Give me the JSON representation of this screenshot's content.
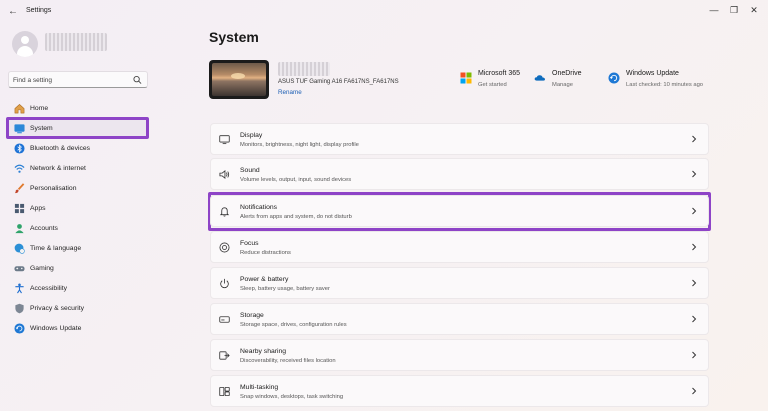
{
  "window": {
    "title": "Settings",
    "back_glyph": "←",
    "controls": {
      "minimize": "—",
      "maximize": "❐",
      "close": "✕"
    }
  },
  "account": {
    "avatar": "user-avatar",
    "name_redacted": true
  },
  "search": {
    "placeholder": "Find a setting"
  },
  "sidebar": {
    "items": [
      {
        "label": "Home",
        "icon": "home-icon",
        "active": false
      },
      {
        "label": "System",
        "icon": "system-icon",
        "active": true
      },
      {
        "label": "Bluetooth & devices",
        "icon": "bluetooth-icon",
        "active": false
      },
      {
        "label": "Network & internet",
        "icon": "wifi-icon",
        "active": false
      },
      {
        "label": "Personalisation",
        "icon": "brush-icon",
        "active": false
      },
      {
        "label": "Apps",
        "icon": "apps-icon",
        "active": false
      },
      {
        "label": "Accounts",
        "icon": "accounts-icon",
        "active": false
      },
      {
        "label": "Time & language",
        "icon": "globe-clock-icon",
        "active": false
      },
      {
        "label": "Gaming",
        "icon": "gamepad-icon",
        "active": false
      },
      {
        "label": "Accessibility",
        "icon": "accessibility-icon",
        "active": false
      },
      {
        "label": "Privacy & security",
        "icon": "shield-icon",
        "active": false
      },
      {
        "label": "Windows Update",
        "icon": "update-icon",
        "active": false
      }
    ]
  },
  "main": {
    "title": "System",
    "device": {
      "model": "ASUS TUF Gaming A16 FA617NS_FA617NS",
      "rename": "Rename",
      "name_redacted": true
    },
    "quick_links": [
      {
        "title": "Microsoft 365",
        "subtitle": "Get started",
        "icon": "microsoft-365-icon"
      },
      {
        "title": "OneDrive",
        "subtitle": "Manage",
        "icon": "onedrive-icon"
      },
      {
        "title": "Windows Update",
        "subtitle": "Last checked: 10 minutes ago",
        "icon": "windows-update-icon"
      }
    ],
    "cards": [
      {
        "title": "Display",
        "subtitle": "Monitors, brightness, night light, display profile",
        "icon": "display-icon"
      },
      {
        "title": "Sound",
        "subtitle": "Volume levels, output, input, sound devices",
        "icon": "sound-icon"
      },
      {
        "title": "Notifications",
        "subtitle": "Alerts from apps and system, do not disturb",
        "icon": "bell-icon"
      },
      {
        "title": "Focus",
        "subtitle": "Reduce distractions",
        "icon": "focus-icon"
      },
      {
        "title": "Power & battery",
        "subtitle": "Sleep, battery usage, battery saver",
        "icon": "power-icon"
      },
      {
        "title": "Storage",
        "subtitle": "Storage space, drives, configuration rules",
        "icon": "storage-icon"
      },
      {
        "title": "Nearby sharing",
        "subtitle": "Discoverability, received files location",
        "icon": "nearby-sharing-icon"
      },
      {
        "title": "Multi-tasking",
        "subtitle": "Snap windows, desktops, task switching",
        "icon": "multitasking-icon"
      }
    ]
  },
  "annotations": {
    "highlight_color": "#8e44c7"
  },
  "colors": {
    "accent": "#0067c0",
    "link": "#1d5fb4",
    "highlight": "#8e44c7"
  }
}
